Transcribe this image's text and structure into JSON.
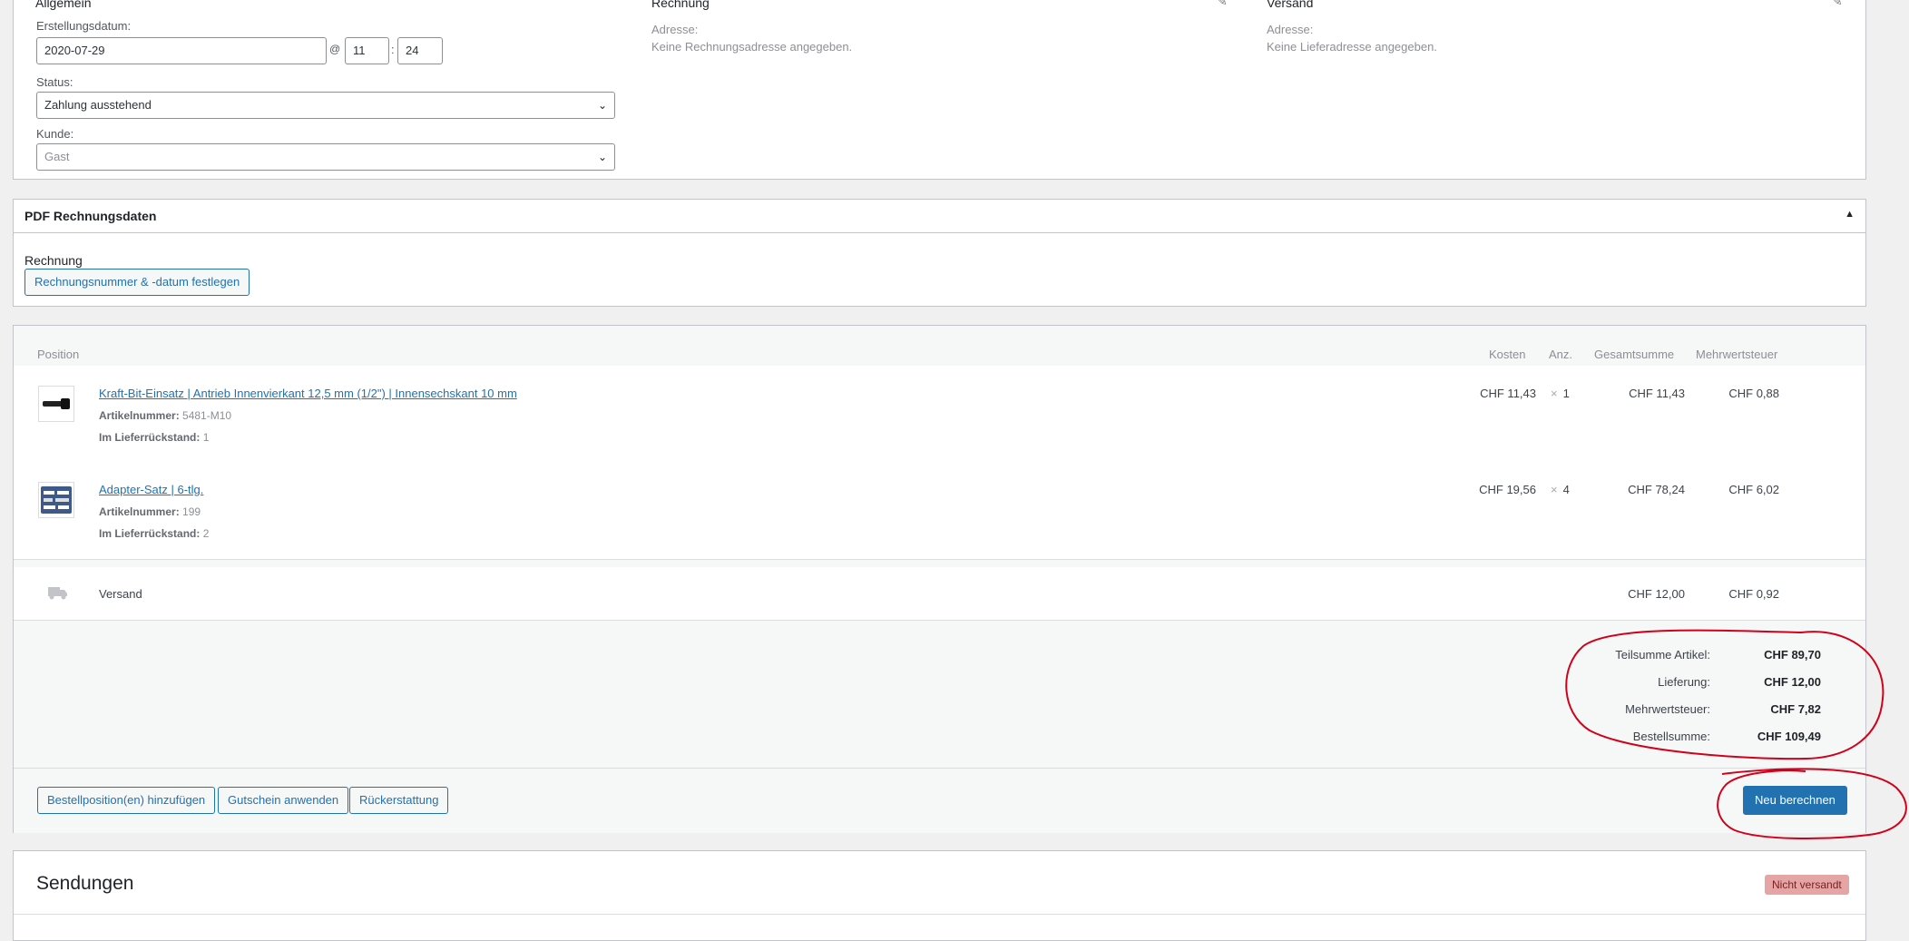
{
  "general": {
    "title": "Allgemein",
    "created_label": "Erstellungsdatum:",
    "created_date": "2020-07-29",
    "at_sign": "@",
    "hour": "11",
    "time_sep": ":",
    "minute": "24",
    "status_label": "Status:",
    "status_value": "Zahlung ausstehend",
    "customer_label": "Kunde:",
    "customer_value": "Gast"
  },
  "billing": {
    "title": "Rechnung",
    "address_label": "Adresse:",
    "address_value": "Keine Rechnungsadresse angegeben."
  },
  "shipping": {
    "title": "Versand",
    "address_label": "Adresse:",
    "address_value": "Keine Lieferadresse angegeben."
  },
  "pdf": {
    "title": "PDF Rechnungsdaten",
    "section_label": "Rechnung",
    "button_label": "Rechnungsnummer & -datum festlegen"
  },
  "items": {
    "headers": {
      "position": "Position",
      "cost": "Kosten",
      "qty": "Anz.",
      "total": "Gesamtsumme",
      "vat": "Mehrwertsteuer"
    },
    "rows": [
      {
        "name": "Kraft-Bit-Einsatz | Antrieb Innenvierkant 12,5 mm (1/2\") | Innensechskant 10 mm",
        "sku_label": "Artikelnummer:",
        "sku": "5481-M10",
        "backorder_label": "Im Lieferrückstand:",
        "backorder": "1",
        "cost": "CHF 11,43",
        "qty_prefix": "×",
        "qty": "1",
        "total": "CHF 11,43",
        "vat": "CHF 0,88"
      },
      {
        "name": "Adapter-Satz | 6-tlg.",
        "sku_label": "Artikelnummer:",
        "sku": "199",
        "backorder_label": "Im Lieferrückstand:",
        "backorder": "2",
        "cost": "CHF 19,56",
        "qty_prefix": "×",
        "qty": "4",
        "total": "CHF 78,24",
        "vat": "CHF 6,02"
      }
    ],
    "shipping_row": {
      "label": "Versand",
      "total": "CHF 12,00",
      "vat": "CHF 0,92"
    }
  },
  "totals": {
    "rows": [
      {
        "label": "Teilsumme Artikel:",
        "value": "CHF 89,70"
      },
      {
        "label": "Lieferung:",
        "value": "CHF 12,00"
      },
      {
        "label": "Mehrwertsteuer:",
        "value": "CHF 7,82"
      },
      {
        "label": "Bestellsumme:",
        "value": "CHF 109,49"
      }
    ]
  },
  "actions": {
    "add_items": "Bestellposition(en) hinzufügen",
    "apply_coupon": "Gutschein anwenden",
    "refund": "Rückerstattung",
    "recalculate": "Neu berechnen"
  },
  "shipments": {
    "title": "Sendungen",
    "status_badge": "Nicht versandt"
  },
  "colors": {
    "accent": "#2271b1",
    "annotation": "#d0021b",
    "badge": "#e5a5a5"
  }
}
